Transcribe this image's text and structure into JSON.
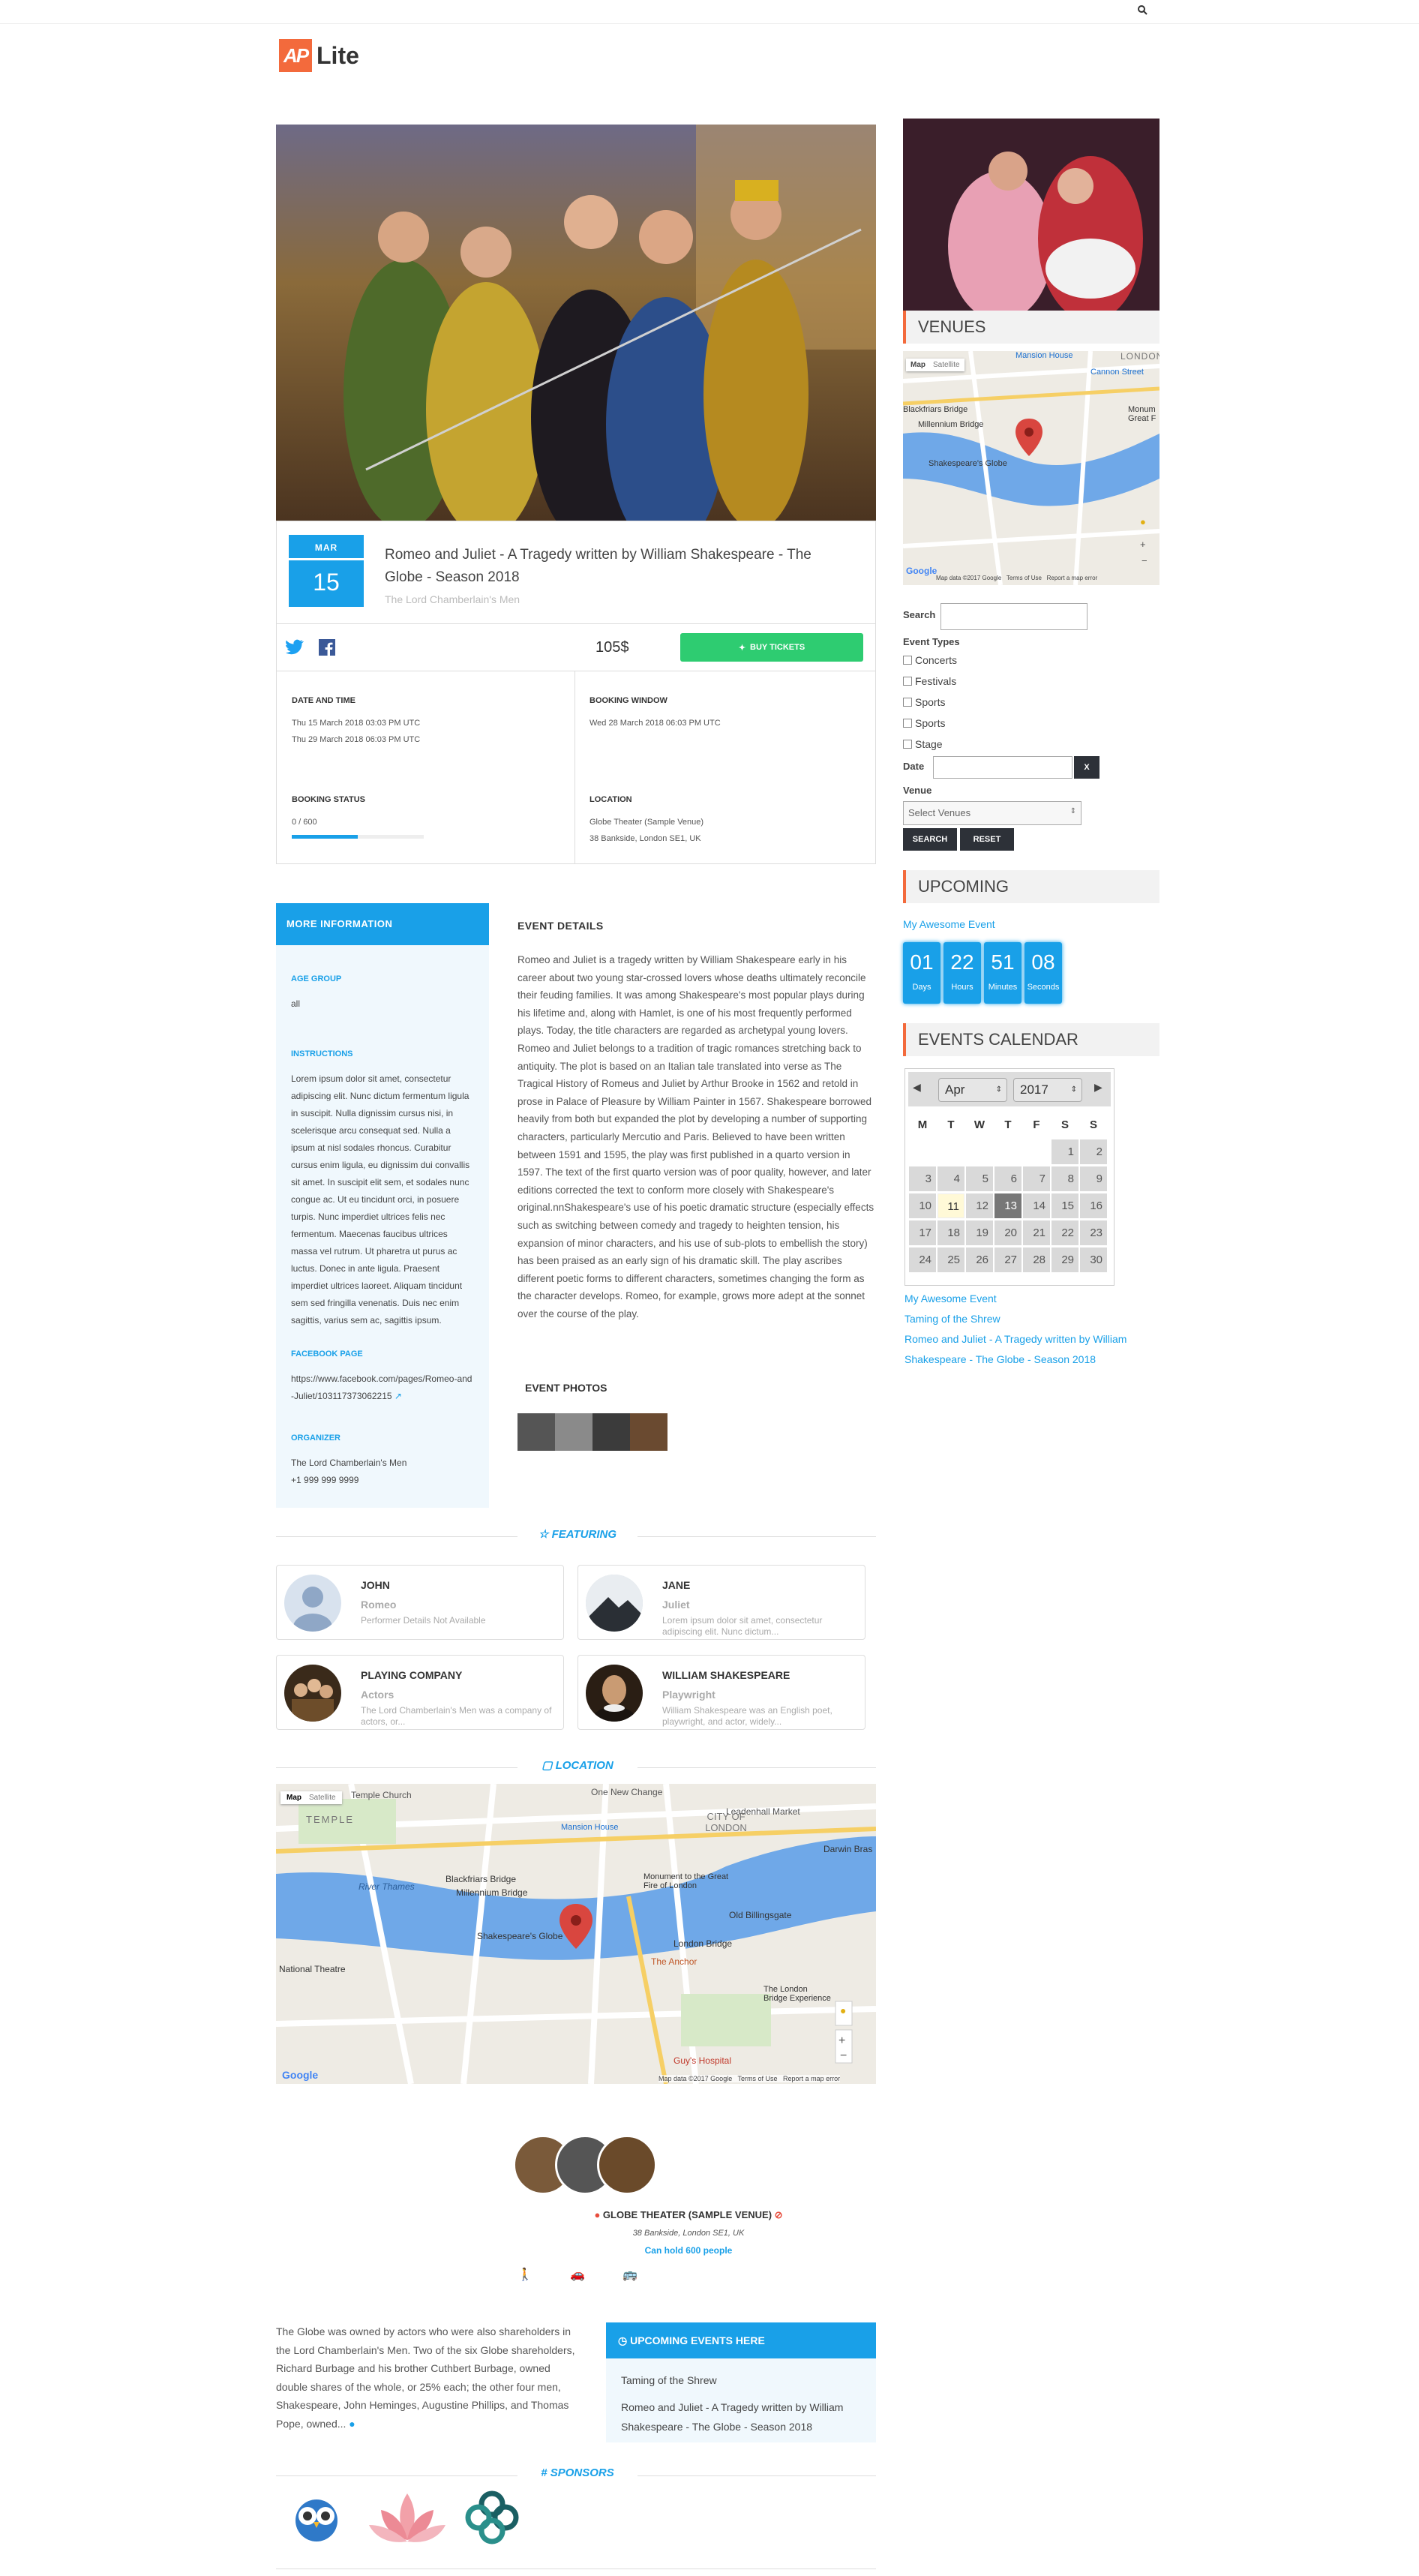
{
  "app": {
    "logo_mark": "AP",
    "logo_text": "Lite"
  },
  "event": {
    "month": "MAR",
    "day": "15",
    "title": "Romeo and Juliet - A Tragedy written by William Shakespeare - The Globe - Season 2018",
    "organizer_line": "The Lord Chamberlain's Men",
    "price": "105$",
    "buy_label": "BUY TICKETS",
    "date_time_heading": "DATE AND TIME",
    "date_time_lines": [
      "Thu 15 March 2018 03:03 PM UTC",
      "Thu 29 March 2018 06:03 PM UTC"
    ],
    "booking_window_heading": "BOOKING WINDOW",
    "booking_window": "Wed 28 March 2018 06:03 PM UTC",
    "booking_status_heading": "BOOKING STATUS",
    "booking_status": "0 / 600",
    "booking_progress": 0.5,
    "location_heading": "LOCATION",
    "location_lines": [
      "Globe Theater (Sample Venue)",
      "38 Bankside, London SE1, UK"
    ]
  },
  "more_info": {
    "heading": "MORE INFORMATION",
    "age_group_heading": "AGE GROUP",
    "age_group": "all",
    "instructions_heading": "INSTRUCTIONS",
    "instructions": "Lorem ipsum dolor sit amet, consectetur adipiscing elit. Nunc dictum fermentum ligula in suscipit. Nulla dignissim cursus nisi, in scelerisque arcu consequat sed. Nulla a ipsum at nisl sodales rhoncus. Curabitur cursus enim ligula, eu dignissim dui convallis sit amet. In suscipit elit sem, et sodales nunc congue ac. Ut eu tincidunt orci, in posuere turpis. Nunc imperdiet ultrices felis nec fermentum. Maecenas faucibus ultrices massa vel rutrum. Ut pharetra ut purus ac luctus. Donec in ante ligula. Praesent imperdiet ultrices laoreet. Aliquam tincidunt sem sed fringilla venenatis. Duis nec enim sagittis, varius sem ac, sagittis ipsum.",
    "facebook_heading": "FACEBOOK PAGE",
    "facebook_url": "https://www.facebook.com/pages/Romeo-and-Juliet/103117373062215",
    "organizer_heading": "ORGANIZER",
    "organizer_name": "The Lord Chamberlain's Men",
    "organizer_phone": "+1 999 999 9999"
  },
  "details": {
    "heading": "EVENT DETAILS",
    "text": "Romeo and Juliet is a tragedy written by William Shakespeare early in his career about two young star-crossed lovers whose deaths ultimately reconcile their feuding families. It was among Shakespeare's most popular plays during his lifetime and, along with Hamlet, is one of his most frequently performed plays. Today, the title characters are regarded as archetypal young lovers. Romeo and Juliet belongs to a tradition of tragic romances stretching back to antiquity. The plot is based on an Italian tale translated into verse as The Tragical History of Romeus and Juliet by Arthur Brooke in 1562 and retold in prose in Palace of Pleasure by William Painter in 1567. Shakespeare borrowed heavily from both but expanded the plot by developing a number of supporting characters, particularly Mercutio and Paris. Believed to have been written between 1591 and 1595, the play was first published in a quarto version in 1597. The text of the first quarto version was of poor quality, however, and later editions corrected the text to conform more closely with Shakespeare's original.nnShakespeare's use of his poetic dramatic structure (especially effects such as switching between comedy and tragedy to heighten tension, his expansion of minor characters, and his use of sub-plots to embellish the story) has been praised as an early sign of his dramatic skill. The play ascribes different poetic forms to different characters, sometimes changing the form as the character develops. Romeo, for example, grows more adept at the sonnet over the course of the play.",
    "photos_heading": "EVENT PHOTOS"
  },
  "featuring": {
    "heading": "FEATURING",
    "performers": [
      {
        "name": "JOHN",
        "role": "Romeo",
        "desc": "Performer Details Not Available"
      },
      {
        "name": "JANE",
        "role": "Juliet",
        "desc": "Lorem ipsum dolor sit amet, consectetur adipiscing elit. Nunc dictum..."
      },
      {
        "name": "PLAYING COMPANY",
        "role": "Actors",
        "desc": "The Lord Chamberlain's Men was a company of actors, or..."
      },
      {
        "name": "WILLIAM SHAKESPEARE",
        "role": "Playwright",
        "desc": "William Shakespeare was an English poet, playwright, and actor, widely..."
      }
    ]
  },
  "location": {
    "heading": "LOCATION",
    "map_tabs": [
      "Map",
      "Satellite"
    ],
    "map_labels": [
      "Temple Church",
      "One New Change",
      "Leadenhall Market",
      "TEMPLE",
      "CITY OF LONDON",
      "Mansion House",
      "Blackfriars Bridge",
      "Millennium Bridge",
      "River Thames",
      "Shakespeare's Globe",
      "Monument to the Great Fire of London",
      "Old Billingsgate",
      "London Bridge",
      "The Anchor",
      "The London Bridge Experience",
      "National Theatre",
      "Guy's Hospital",
      "Darwin Bras"
    ],
    "map_footer": "Map data ©2017 Google   Terms of Use   Report a map error",
    "google": "Google"
  },
  "venue": {
    "name": "GLOBE THEATER (SAMPLE VENUE)",
    "address": "38 Bankside, London SE1, UK",
    "capacity": "Can hold 600 people",
    "description": "The Globe was owned by actors who were also shareholders in the Lord Chamberlain's Men. Two of the six Globe shareholders, Richard Burbage and his brother Cuthbert Burbage, owned double shares of the whole, or 25% each; the other four men, Shakespeare, John Heminges, Augustine Phillips, and Thomas Pope, owned...",
    "upcoming_heading": "UPCOMING EVENTS HERE",
    "upcoming": [
      "Taming of the Shrew",
      "Romeo and Juliet - A Tragedy written by William Shakespeare - The Globe - Season 2018"
    ]
  },
  "sponsors": {
    "heading": "SPONSORS"
  },
  "sidebar": {
    "venues_heading": "VENUES",
    "small_map_tabs": [
      "Map",
      "Satellite"
    ],
    "small_map_labels": [
      "Mansion House",
      "Cannon Street",
      "LONDON",
      "Blackfriars Bridge",
      "Millennium Bridge",
      "Shakespeare's Globe",
      "Monum Great F"
    ],
    "small_map_footer": "Map data ©2017 Google   Terms of Use   Report a map error",
    "search_label": "Search",
    "event_types_label": "Event Types",
    "event_types": [
      "Concerts",
      "Festivals",
      "Sports",
      "Sports",
      "Stage"
    ],
    "date_label": "Date",
    "date_clear": "X",
    "venue_label": "Venue",
    "venue_placeholder": "Select Venues",
    "search_btn": "SEARCH",
    "reset_btn": "RESET",
    "upcoming_heading": "UPCOMING",
    "upcoming_event": "My Awesome Event",
    "countdown": [
      {
        "value": "01",
        "label": "Days"
      },
      {
        "value": "22",
        "label": "Hours"
      },
      {
        "value": "51",
        "label": "Minutes"
      },
      {
        "value": "08",
        "label": "Seconds"
      }
    ],
    "calendar_heading": "EVENTS CALENDAR",
    "cal_month": "Apr",
    "cal_year": "2017",
    "cal_days": [
      "M",
      "T",
      "W",
      "T",
      "F",
      "S",
      "S"
    ],
    "cal_links": [
      "My Awesome Event",
      "Taming of the Shrew",
      "Romeo and Juliet - A Tragedy written by William Shakespeare - The Globe - Season 2018"
    ]
  }
}
